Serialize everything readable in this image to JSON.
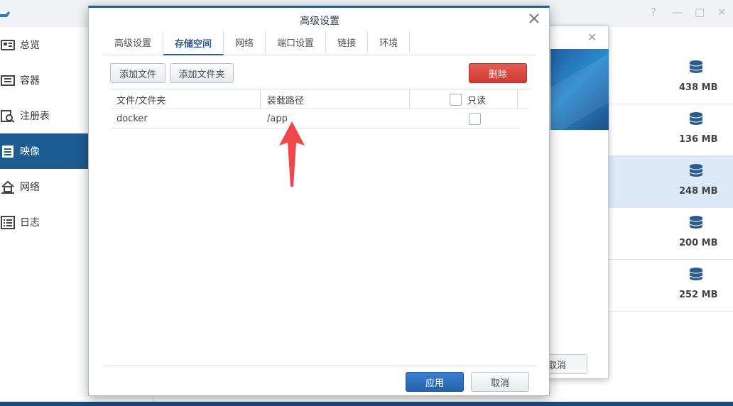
{
  "sidebar": {
    "items": [
      {
        "label": "总览",
        "icon": "overview-icon"
      },
      {
        "label": "容器",
        "icon": "container-icon"
      },
      {
        "label": "注册表",
        "icon": "registry-search-icon"
      },
      {
        "label": "映像",
        "icon": "image-icon",
        "active": true
      },
      {
        "label": "网络",
        "icon": "network-home-icon"
      },
      {
        "label": "日志",
        "icon": "log-list-icon"
      }
    ]
  },
  "window_controls": [
    "?",
    "—",
    "□",
    "✕"
  ],
  "images": {
    "rows": [
      {
        "size": "438 MB"
      },
      {
        "size": "136 MB"
      },
      {
        "size": "248 MB",
        "selected": true
      },
      {
        "size": "200 MB"
      },
      {
        "size": "252 MB"
      }
    ]
  },
  "mid_dialog": {
    "cancel_label": "取消"
  },
  "dialog": {
    "title": "高级设置",
    "tabs": [
      {
        "label": "高级设置"
      },
      {
        "label": "存储空间",
        "active": true
      },
      {
        "label": "网络"
      },
      {
        "label": "端口设置"
      },
      {
        "label": "链接"
      },
      {
        "label": "环境"
      }
    ],
    "add_file_label": "添加文件",
    "add_folder_label": "添加文件夹",
    "delete_label": "删除",
    "table": {
      "headers": {
        "file": "文件/文件夹",
        "path": "装载路径",
        "readonly": "只读"
      },
      "rows": [
        {
          "file": "docker",
          "path": "/app",
          "readonly": false
        }
      ]
    },
    "apply_label": "应用",
    "cancel_label": "取消"
  },
  "colors": {
    "accent": "#2c5c8f",
    "sidebar_active": "#1e5b91",
    "delete": "#d9443b",
    "apply": "#2d6fbf",
    "arrow": "#f0474a"
  }
}
